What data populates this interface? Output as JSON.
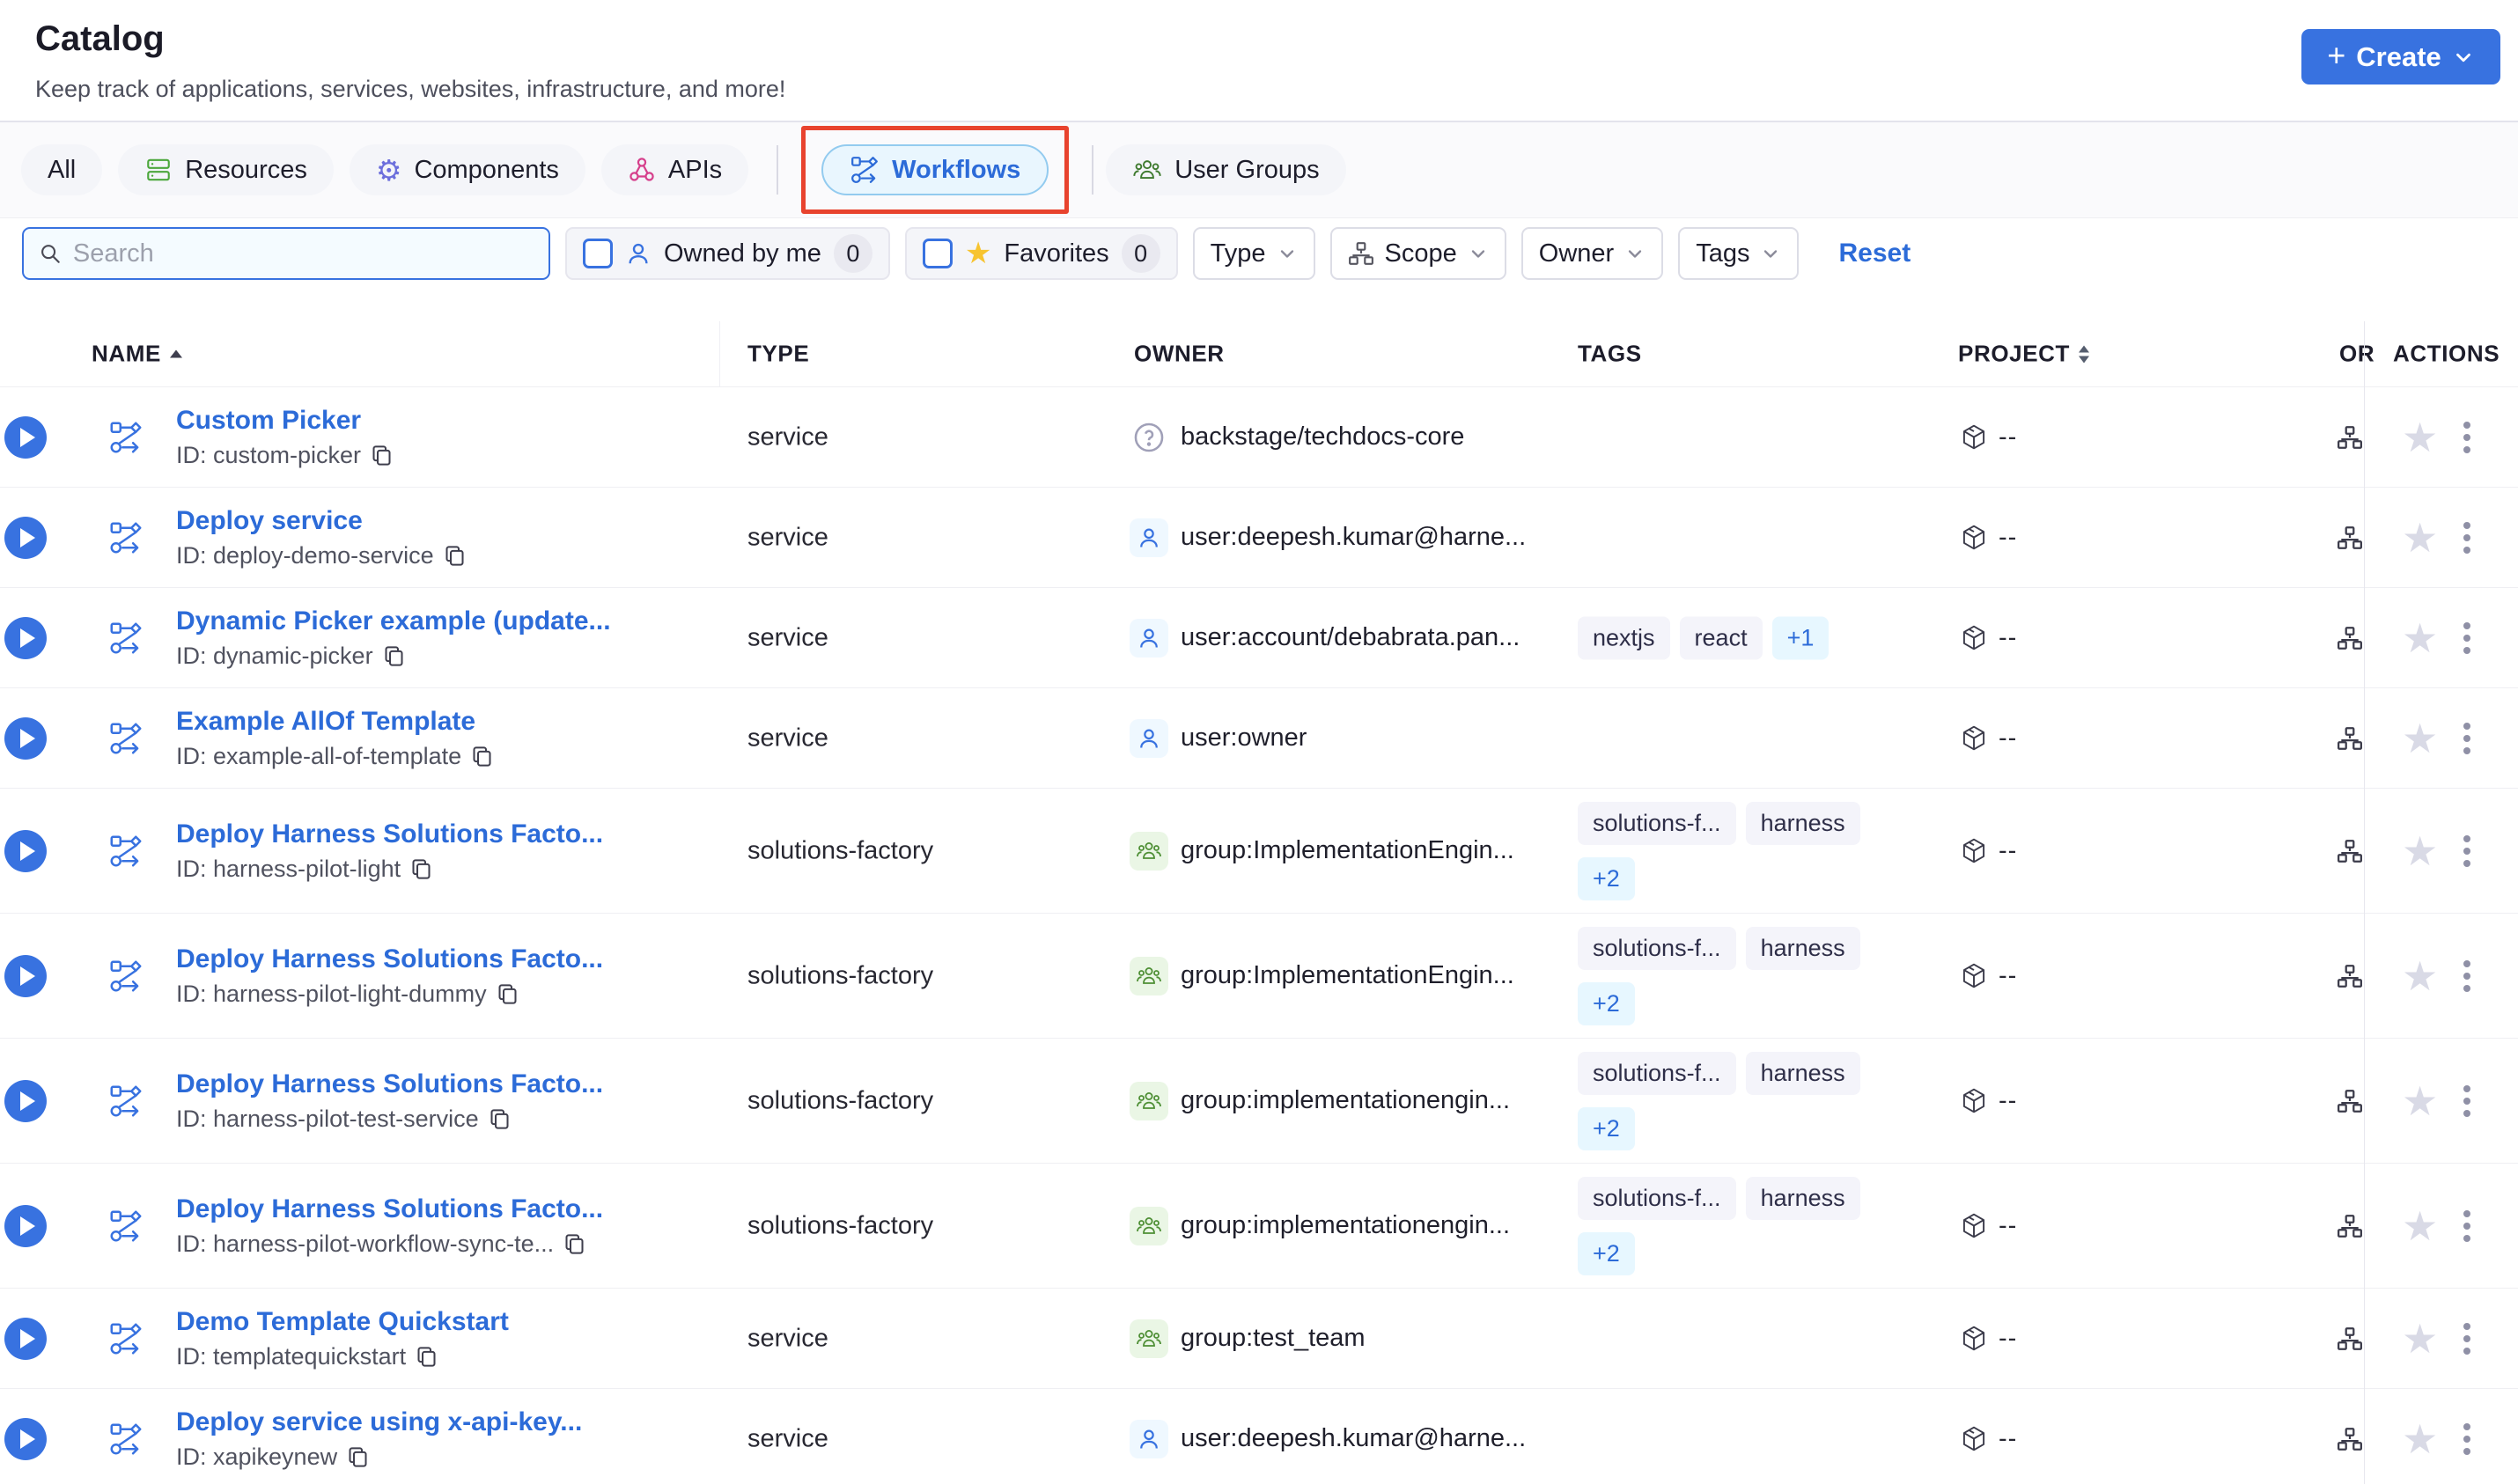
{
  "header": {
    "title": "Catalog",
    "subtitle": "Keep track of applications, services, websites, infrastructure, and more!",
    "create_label": "Create"
  },
  "tabs": [
    {
      "label": "All"
    },
    {
      "label": "Resources",
      "icon": "resources-icon"
    },
    {
      "label": "Components",
      "icon": "components-icon"
    },
    {
      "label": "APIs",
      "icon": "apis-icon"
    },
    {
      "label": "Workflows",
      "icon": "workflows-icon",
      "selected": true,
      "annotated": true
    },
    {
      "label": "User Groups",
      "icon": "user-groups-icon"
    }
  ],
  "filters": {
    "search_placeholder": "Search",
    "owned_by_me": {
      "label": "Owned by me",
      "count": "0"
    },
    "favorites": {
      "label": "Favorites",
      "count": "0"
    },
    "dropdowns": [
      {
        "label": "Type"
      },
      {
        "label": "Scope",
        "icon": "hierarchy-icon"
      },
      {
        "label": "Owner"
      },
      {
        "label": "Tags"
      }
    ],
    "reset_label": "Reset"
  },
  "table": {
    "columns": [
      "NAME",
      "TYPE",
      "OWNER",
      "TAGS",
      "PROJECT",
      "OR",
      "ACTIONS"
    ],
    "project_value": "--",
    "rows": [
      {
        "name": "Custom Picker",
        "id": "ID: custom-picker",
        "type": "service",
        "owner": "backstage/techdocs-core",
        "owner_kind": "unknown",
        "tags": [],
        "tall": false
      },
      {
        "name": "Deploy service",
        "id": "ID: deploy-demo-service",
        "type": "service",
        "owner": "user:deepesh.kumar@harne...",
        "owner_kind": "user",
        "tags": [],
        "tall": false
      },
      {
        "name": "Dynamic Picker example (update...",
        "id": "ID: dynamic-picker",
        "type": "service",
        "owner": "user:account/debabrata.pan...",
        "owner_kind": "user",
        "tags": [
          {
            "label": "nextjs",
            "style": "default"
          },
          {
            "label": "react",
            "style": "default"
          },
          {
            "label": "+1",
            "style": "count"
          }
        ],
        "tall": false
      },
      {
        "name": "Example AllOf Template",
        "id": "ID: example-all-of-template",
        "type": "service",
        "owner": "user:owner",
        "owner_kind": "user",
        "tags": [],
        "tall": false
      },
      {
        "name": "Deploy Harness Solutions Facto...",
        "id": "ID: harness-pilot-light",
        "type": "solutions-factory",
        "owner": "group:ImplementationEngin...",
        "owner_kind": "group",
        "tags": [
          {
            "label": "solutions-f...",
            "style": "default"
          },
          {
            "label": "harness",
            "style": "default"
          },
          {
            "label": "+2",
            "style": "count"
          }
        ],
        "tall": true
      },
      {
        "name": "Deploy Harness Solutions Facto...",
        "id": "ID: harness-pilot-light-dummy",
        "type": "solutions-factory",
        "owner": "group:ImplementationEngin...",
        "owner_kind": "group",
        "tags": [
          {
            "label": "solutions-f...",
            "style": "default"
          },
          {
            "label": "harness",
            "style": "default"
          },
          {
            "label": "+2",
            "style": "count"
          }
        ],
        "tall": true
      },
      {
        "name": "Deploy Harness Solutions Facto...",
        "id": "ID: harness-pilot-test-service",
        "type": "solutions-factory",
        "owner": "group:implementationengin...",
        "owner_kind": "group",
        "tags": [
          {
            "label": "solutions-f...",
            "style": "default"
          },
          {
            "label": "harness",
            "style": "default"
          },
          {
            "label": "+2",
            "style": "count"
          }
        ],
        "tall": true
      },
      {
        "name": "Deploy Harness Solutions Facto...",
        "id": "ID: harness-pilot-workflow-sync-te...",
        "type": "solutions-factory",
        "owner": "group:implementationengin...",
        "owner_kind": "group",
        "tags": [
          {
            "label": "solutions-f...",
            "style": "default"
          },
          {
            "label": "harness",
            "style": "default"
          },
          {
            "label": "+2",
            "style": "count"
          }
        ],
        "tall": true
      },
      {
        "name": "Demo Template Quickstart",
        "id": "ID: templatequickstart",
        "type": "service",
        "owner": "group:test_team",
        "owner_kind": "group",
        "tags": [],
        "tall": false
      },
      {
        "name": "Deploy service using x-api-key...",
        "id": "ID: xapikeynew",
        "type": "service",
        "owner": "user:deepesh.kumar@harne...",
        "owner_kind": "user",
        "tags": [],
        "tall": false
      }
    ]
  },
  "colors": {
    "primary_blue": "#3872E0",
    "link_blue": "#2C6BD8",
    "annotation_red": "#E8432E",
    "selected_tab_bg": "#E9F6FE",
    "tag_bg": "#F4F4FA",
    "tag_count_bg": "#E7F7FF",
    "group_green": "#4E8F35",
    "favorite_yellow": "#F7C430",
    "star_gray": "#D9DAE6"
  }
}
